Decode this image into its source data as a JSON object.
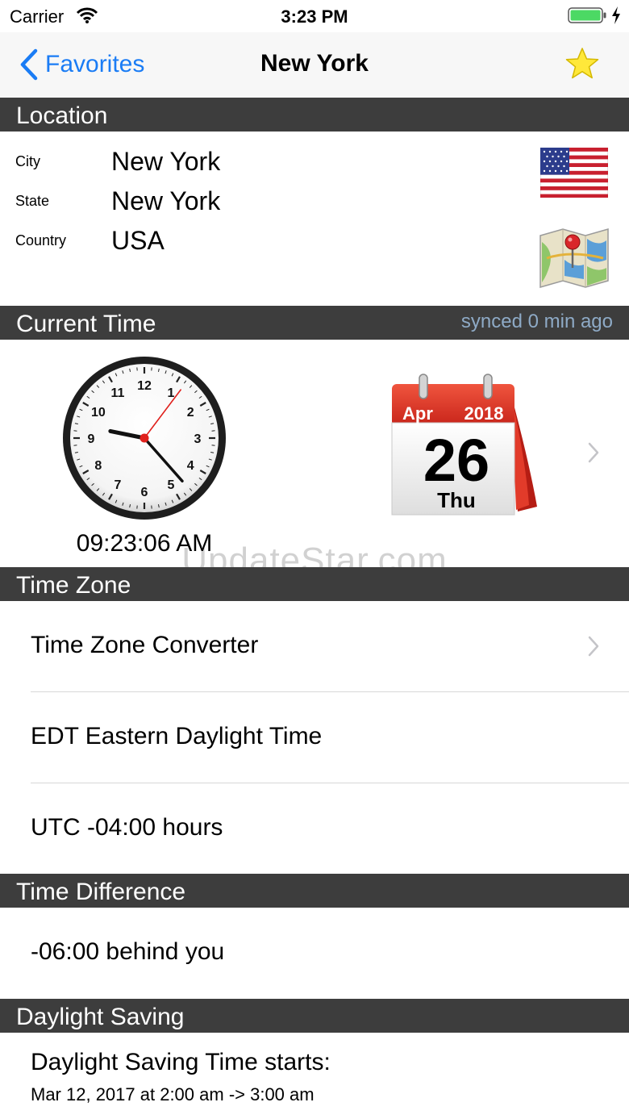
{
  "status_bar": {
    "carrier": "Carrier",
    "time": "3:23 PM",
    "battery_color": "#4cd964"
  },
  "nav": {
    "back_label": "Favorites",
    "title": "New York",
    "accent": "#1a7cf5"
  },
  "location": {
    "header": "Location",
    "city_label": "City",
    "city": "New York",
    "state_label": "State",
    "state": "New York",
    "country_label": "Country",
    "country": "USA"
  },
  "current_time": {
    "header": "Current Time",
    "synced": "synced 0 min ago",
    "clock_numbers": [
      "12",
      "1",
      "2",
      "3",
      "4",
      "5",
      "6",
      "7",
      "8",
      "9",
      "10",
      "11"
    ],
    "clock_digital": "09:23:06 AM",
    "calendar_month": "Apr",
    "calendar_year": "2018",
    "calendar_day": "26",
    "calendar_weekday": "Thu"
  },
  "time_zone": {
    "header": "Time Zone",
    "converter": "Time Zone Converter",
    "zone_name": "EDT Eastern Daylight Time",
    "utc_offset": "UTC -04:00 hours"
  },
  "time_difference": {
    "header": "Time Difference",
    "value": "-06:00 behind you"
  },
  "daylight_saving": {
    "header": "Daylight Saving",
    "title": "Daylight Saving Time starts:",
    "detail": "Mar 12, 2017 at 2:00 am -> 3:00 am"
  },
  "watermark": "UpdateStar.com"
}
